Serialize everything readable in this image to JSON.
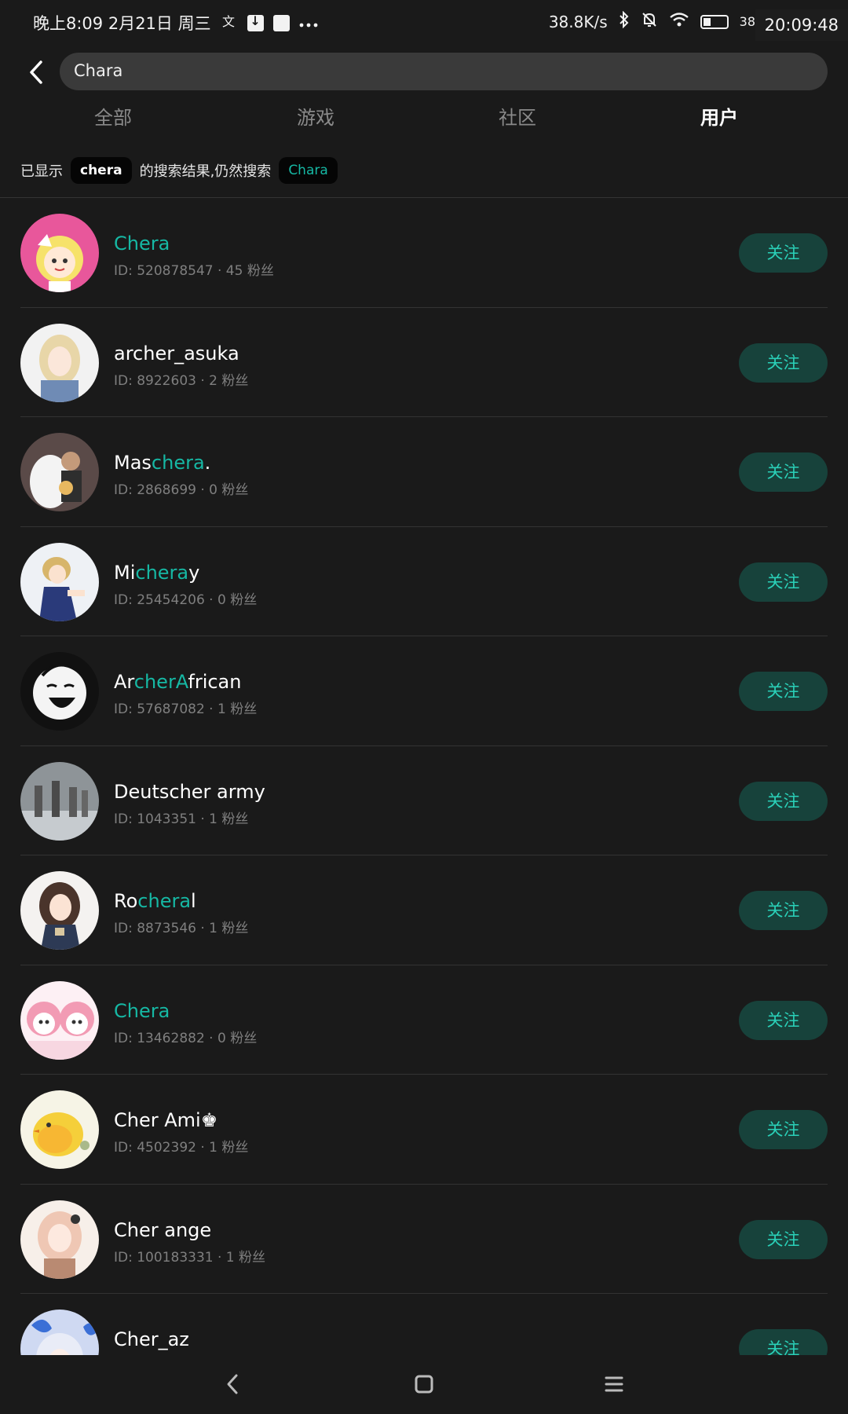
{
  "status_bar": {
    "left_text": "晚上8:09 2月21日 周三",
    "net_speed": "38.8K/s",
    "battery_level": "38",
    "clock": "20:09:48"
  },
  "search": {
    "query": "Chara"
  },
  "tabs": [
    {
      "label": "全部",
      "active": false
    },
    {
      "label": "游戏",
      "active": false
    },
    {
      "label": "社区",
      "active": false
    },
    {
      "label": "用户",
      "active": true
    }
  ],
  "hint": {
    "prefix": "已显示",
    "shown_term": "chera",
    "middle": "的搜索结果,仍然搜索",
    "original_term": "Chara"
  },
  "follow_label": "关注",
  "accent_color": "#16b8a4",
  "users": [
    {
      "name": [
        {
          "t": "Chera",
          "hl": true
        }
      ],
      "meta": "ID: 520878547 · 45 粉丝",
      "avatar": "anime-yellow-hair-icon"
    },
    {
      "name": [
        {
          "t": "archer_asuka",
          "hl": false
        }
      ],
      "meta": "ID: 8922603 · 2 粉丝",
      "avatar": "anime-blonde-girl-icon"
    },
    {
      "name": [
        {
          "t": "Mas",
          "hl": false
        },
        {
          "t": "chera",
          "hl": true
        },
        {
          "t": ".",
          "hl": false
        }
      ],
      "meta": "ID: 2868699 · 0 粉丝",
      "avatar": "photo-wedding-icon"
    },
    {
      "name": [
        {
          "t": "Mi",
          "hl": false
        },
        {
          "t": "chera",
          "hl": true
        },
        {
          "t": "y",
          "hl": false
        }
      ],
      "meta": "ID: 25454206 · 0 粉丝",
      "avatar": "anime-boy-blue-coat-icon"
    },
    {
      "name": [
        {
          "t": "Ar",
          "hl": false
        },
        {
          "t": "cherA",
          "hl": true
        },
        {
          "t": "frican",
          "hl": false
        }
      ],
      "meta": "ID: 57687082 · 1 粉丝",
      "avatar": "manga-laughing-face-icon"
    },
    {
      "name": [
        {
          "t": "Deutscher army",
          "hl": false
        }
      ],
      "meta": "ID: 1043351 · 1 粉丝",
      "avatar": "photo-soldiers-icon"
    },
    {
      "name": [
        {
          "t": "Ro",
          "hl": false
        },
        {
          "t": "chera",
          "hl": true
        },
        {
          "t": "l",
          "hl": false
        }
      ],
      "meta": "ID: 8873546 · 1 粉丝",
      "avatar": "anime-brown-hair-girl-icon"
    },
    {
      "name": [
        {
          "t": "Chera",
          "hl": true
        }
      ],
      "meta": "ID: 13462882 · 0 粉丝",
      "avatar": "chibi-pink-twins-icon"
    },
    {
      "name": [
        {
          "t": "Cher Ami♚",
          "hl": false
        }
      ],
      "meta": "ID: 4502392 · 1 粉丝",
      "avatar": "yellow-chick-icon"
    },
    {
      "name": [
        {
          "t": "Cher ange",
          "hl": false
        }
      ],
      "meta": "ID: 100183331 · 1 粉丝",
      "avatar": "anime-pink-hair-girl-icon"
    },
    {
      "name": [
        {
          "t": "Cher_az",
          "hl": false
        }
      ],
      "meta": "",
      "avatar": "anime-blue-butterfly-icon"
    }
  ]
}
